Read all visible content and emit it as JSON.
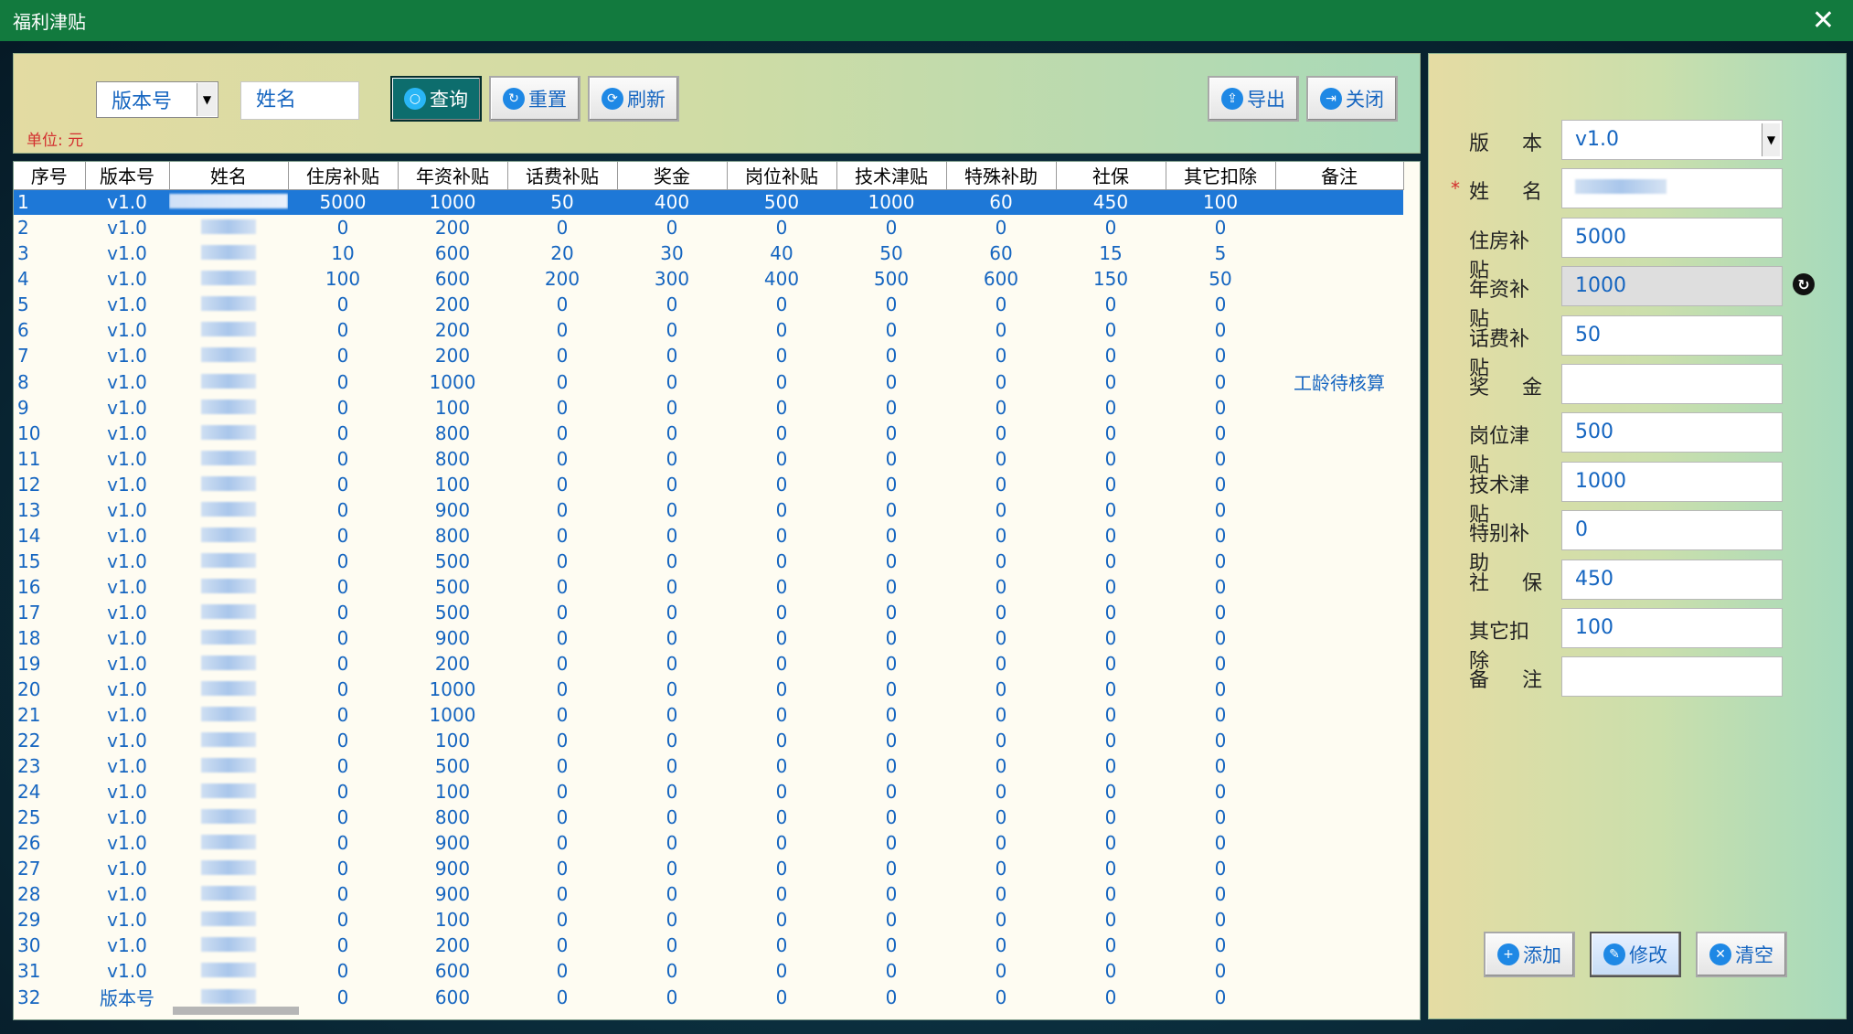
{
  "window": {
    "title": "福利津贴"
  },
  "toolbar": {
    "version_select": "版本号",
    "name_placeholder": "姓名",
    "unit_label": "单位: 元",
    "query_label": "查询",
    "reset_label": "重置",
    "refresh_label": "刷新",
    "export_label": "导出",
    "close_label": "关闭"
  },
  "table": {
    "columns": [
      "序号",
      "版本号",
      "姓名",
      "住房补贴",
      "年资补贴",
      "话费补贴",
      "奖金",
      "岗位补贴",
      "技术津贴",
      "特殊补助",
      "社保",
      "其它扣除",
      "备注"
    ],
    "rows": [
      [
        "1",
        "v1.0",
        "",
        "5000",
        "1000",
        "50",
        "400",
        "500",
        "1000",
        "60",
        "450",
        "100",
        ""
      ],
      [
        "2",
        "v1.0",
        "",
        "0",
        "200",
        "0",
        "0",
        "0",
        "0",
        "0",
        "0",
        "0",
        ""
      ],
      [
        "3",
        "v1.0",
        "",
        "10",
        "600",
        "20",
        "30",
        "40",
        "50",
        "60",
        "15",
        "5",
        ""
      ],
      [
        "4",
        "v1.0",
        "",
        "100",
        "600",
        "200",
        "300",
        "400",
        "500",
        "600",
        "150",
        "50",
        ""
      ],
      [
        "5",
        "v1.0",
        "",
        "0",
        "200",
        "0",
        "0",
        "0",
        "0",
        "0",
        "0",
        "0",
        ""
      ],
      [
        "6",
        "v1.0",
        "",
        "0",
        "200",
        "0",
        "0",
        "0",
        "0",
        "0",
        "0",
        "0",
        ""
      ],
      [
        "7",
        "v1.0",
        "",
        "0",
        "200",
        "0",
        "0",
        "0",
        "0",
        "0",
        "0",
        "0",
        ""
      ],
      [
        "8",
        "v1.0",
        "",
        "0",
        "1000",
        "0",
        "0",
        "0",
        "0",
        "0",
        "0",
        "0",
        "工龄待核算"
      ],
      [
        "9",
        "v1.0",
        "",
        "0",
        "100",
        "0",
        "0",
        "0",
        "0",
        "0",
        "0",
        "0",
        ""
      ],
      [
        "10",
        "v1.0",
        "",
        "0",
        "800",
        "0",
        "0",
        "0",
        "0",
        "0",
        "0",
        "0",
        ""
      ],
      [
        "11",
        "v1.0",
        "",
        "0",
        "800",
        "0",
        "0",
        "0",
        "0",
        "0",
        "0",
        "0",
        ""
      ],
      [
        "12",
        "v1.0",
        "",
        "0",
        "100",
        "0",
        "0",
        "0",
        "0",
        "0",
        "0",
        "0",
        ""
      ],
      [
        "13",
        "v1.0",
        "",
        "0",
        "900",
        "0",
        "0",
        "0",
        "0",
        "0",
        "0",
        "0",
        ""
      ],
      [
        "14",
        "v1.0",
        "",
        "0",
        "800",
        "0",
        "0",
        "0",
        "0",
        "0",
        "0",
        "0",
        ""
      ],
      [
        "15",
        "v1.0",
        "",
        "0",
        "500",
        "0",
        "0",
        "0",
        "0",
        "0",
        "0",
        "0",
        ""
      ],
      [
        "16",
        "v1.0",
        "",
        "0",
        "500",
        "0",
        "0",
        "0",
        "0",
        "0",
        "0",
        "0",
        ""
      ],
      [
        "17",
        "v1.0",
        "",
        "0",
        "500",
        "0",
        "0",
        "0",
        "0",
        "0",
        "0",
        "0",
        ""
      ],
      [
        "18",
        "v1.0",
        "",
        "0",
        "900",
        "0",
        "0",
        "0",
        "0",
        "0",
        "0",
        "0",
        ""
      ],
      [
        "19",
        "v1.0",
        "",
        "0",
        "200",
        "0",
        "0",
        "0",
        "0",
        "0",
        "0",
        "0",
        ""
      ],
      [
        "20",
        "v1.0",
        "",
        "0",
        "1000",
        "0",
        "0",
        "0",
        "0",
        "0",
        "0",
        "0",
        ""
      ],
      [
        "21",
        "v1.0",
        "",
        "0",
        "1000",
        "0",
        "0",
        "0",
        "0",
        "0",
        "0",
        "0",
        ""
      ],
      [
        "22",
        "v1.0",
        "",
        "0",
        "100",
        "0",
        "0",
        "0",
        "0",
        "0",
        "0",
        "0",
        ""
      ],
      [
        "23",
        "v1.0",
        "",
        "0",
        "500",
        "0",
        "0",
        "0",
        "0",
        "0",
        "0",
        "0",
        ""
      ],
      [
        "24",
        "v1.0",
        "",
        "0",
        "100",
        "0",
        "0",
        "0",
        "0",
        "0",
        "0",
        "0",
        ""
      ],
      [
        "25",
        "v1.0",
        "",
        "0",
        "800",
        "0",
        "0",
        "0",
        "0",
        "0",
        "0",
        "0",
        ""
      ],
      [
        "26",
        "v1.0",
        "",
        "0",
        "900",
        "0",
        "0",
        "0",
        "0",
        "0",
        "0",
        "0",
        ""
      ],
      [
        "27",
        "v1.0",
        "",
        "0",
        "900",
        "0",
        "0",
        "0",
        "0",
        "0",
        "0",
        "0",
        ""
      ],
      [
        "28",
        "v1.0",
        "",
        "0",
        "900",
        "0",
        "0",
        "0",
        "0",
        "0",
        "0",
        "0",
        ""
      ],
      [
        "29",
        "v1.0",
        "",
        "0",
        "100",
        "0",
        "0",
        "0",
        "0",
        "0",
        "0",
        "0",
        ""
      ],
      [
        "30",
        "v1.0",
        "",
        "0",
        "200",
        "0",
        "0",
        "0",
        "0",
        "0",
        "0",
        "0",
        ""
      ],
      [
        "31",
        "v1.0",
        "",
        "0",
        "600",
        "0",
        "0",
        "0",
        "0",
        "0",
        "0",
        "0",
        ""
      ],
      [
        "32",
        "版本号",
        "",
        "0",
        "600",
        "0",
        "0",
        "0",
        "0",
        "0",
        "0",
        "0",
        ""
      ]
    ]
  },
  "form": {
    "fields": [
      {
        "label": "版本",
        "value": "v1.0",
        "type": "select"
      },
      {
        "label": "姓名",
        "value": "",
        "required": true
      },
      {
        "label": "住房补贴",
        "value": "5000"
      },
      {
        "label": "年资补贴",
        "value": "1000",
        "readonly": true
      },
      {
        "label": "话费补贴",
        "value": "50"
      },
      {
        "label": "奖金",
        "value": ""
      },
      {
        "label": "岗位津贴",
        "value": "500"
      },
      {
        "label": "技术津贴",
        "value": "1000"
      },
      {
        "label": "特别补助",
        "value": "0"
      },
      {
        "label": "社保",
        "value": "450"
      },
      {
        "label": "其它扣除",
        "value": "100"
      },
      {
        "label": "备注",
        "value": ""
      }
    ],
    "required_mark": "*",
    "add_label": "添加",
    "edit_label": "修改",
    "clear_label": "清空"
  },
  "colors": {
    "titlebar": "#127a3e",
    "selected_row": "#1e78d7",
    "text_value": "#1565c0",
    "required": "#d32f2f"
  }
}
